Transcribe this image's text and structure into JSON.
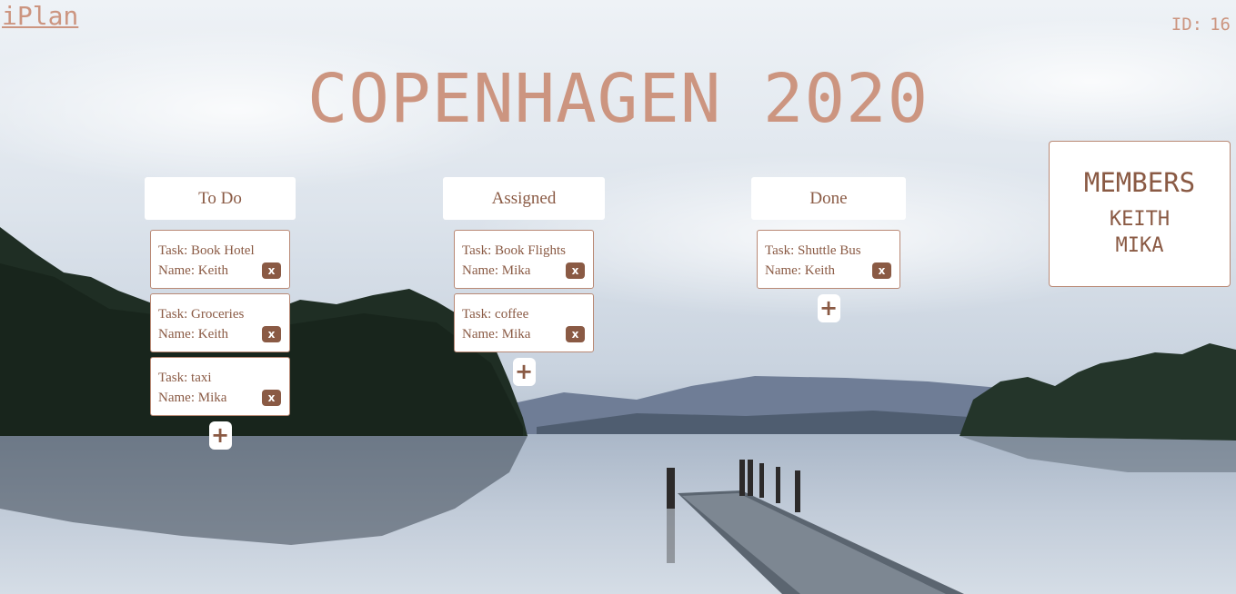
{
  "header": {
    "brand": "iPlan",
    "id_label": "ID:",
    "id_value": "16",
    "title": "COPENHAGEN 2020"
  },
  "columns": [
    {
      "title": "To Do",
      "cards": [
        {
          "task_label": "Task:",
          "task": "Book Hotel",
          "name_label": "Name:",
          "name": "Keith"
        },
        {
          "task_label": "Task:",
          "task": "Groceries",
          "name_label": "Name:",
          "name": "Keith"
        },
        {
          "task_label": "Task:",
          "task": "taxi",
          "name_label": "Name:",
          "name": "Mika"
        }
      ]
    },
    {
      "title": "Assigned",
      "cards": [
        {
          "task_label": "Task:",
          "task": "Book Flights",
          "name_label": "Name:",
          "name": "Mika"
        },
        {
          "task_label": "Task:",
          "task": "coffee",
          "name_label": "Name:",
          "name": "Mika"
        }
      ]
    },
    {
      "title": "Done",
      "cards": [
        {
          "task_label": "Task:",
          "task": "Shuttle Bus",
          "name_label": "Name:",
          "name": "Keith"
        }
      ]
    }
  ],
  "buttons": {
    "delete_label": "x",
    "add_label": "+"
  },
  "members": {
    "title": "MEMBERS",
    "list": [
      "KEITH",
      "MIKA"
    ]
  },
  "colors": {
    "accent": "#cc9580",
    "text": "#8a5a44",
    "card_bg": "#ffffff",
    "delete_bg": "#8a5a44"
  },
  "icons": {
    "delete": "close-icon",
    "add": "plus-icon"
  }
}
